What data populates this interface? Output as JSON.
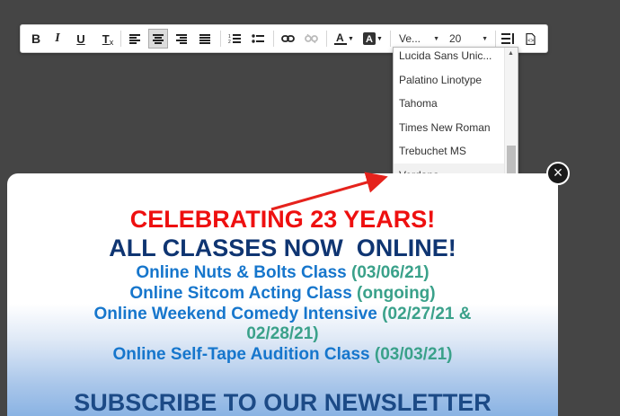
{
  "toolbar": {
    "bold": "B",
    "italic": "I",
    "underline": "U",
    "clear_format": "T",
    "font_family_value": "Ve...",
    "font_size_value": "20"
  },
  "font_dropdown": {
    "options": [
      "Lucida Sans Unic...",
      "Palatino Linotype",
      "Tahoma",
      "Times New Roman",
      "Trebuchet MS",
      "Verdana"
    ],
    "highlighted": "Verdana"
  },
  "popup": {
    "headline1": "CELEBRATING 23 YEARS!",
    "headline2": "ALL CLASSES NOW  ONLINE!",
    "classes": [
      {
        "name": "Online Nuts & Bolts Class",
        "date": "(03/06/21)"
      },
      {
        "name": "Online Sitcom Acting Class",
        "date": "(ongoing)"
      },
      {
        "name": "Online Weekend Comedy Intensive",
        "date": "(02/27/21 &"
      },
      {
        "name": "",
        "date": "02/28/21)"
      },
      {
        "name": "Online Self-Tape Audition Class",
        "date": "(03/03/21)"
      }
    ],
    "subscribe": "SUBSCRIBE TO OUR NEWSLETTER",
    "close_symbol": "×"
  },
  "colors": {
    "background": "#454545",
    "headline_red": "#ee1010",
    "headline_navy": "#0f3572",
    "class_blue": "#1676cc",
    "date_green": "#3aa18a",
    "arrow_red": "#e5221c"
  }
}
